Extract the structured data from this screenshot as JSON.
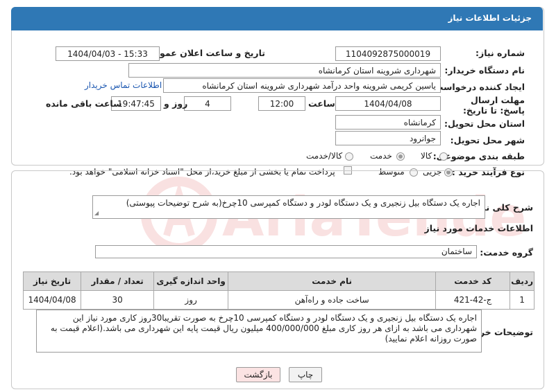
{
  "header": {
    "title": "جزئیات اطلاعات نیاز"
  },
  "fields": {
    "need_number_label": "شماره نیاز:",
    "need_number": "1104092875000019",
    "announce_label": "تاریخ و ساعت اعلان عمومی:",
    "announce_value": "1404/04/03 - 15:33",
    "buyer_org_label": "نام دستگاه خریدار:",
    "buyer_org": "شهرداری شروینه استان کرمانشاه",
    "requester_label": "ایجاد کننده درخواست:",
    "requester": "یاسین کریمی شروینه واحد درآمد شهرداری شروینه استان کرمانشاه",
    "contact_link": "اطلاعات تماس خریدار",
    "deadline_label": "مهلت ارسال پاسخ: تا تاریخ:",
    "deadline_date": "1404/04/08",
    "time_label": "ساعت",
    "deadline_time": "12:00",
    "days_value": "4",
    "days_label": "روز و",
    "remaining_time": "19:47:45",
    "remaining_label": "ساعت باقی مانده",
    "province_label": "استان محل تحویل:",
    "province": "کرمانشاه",
    "city_label": "شهر محل تحویل:",
    "city": "جوانرود",
    "category_label": "طبقه بندی موضوعی:",
    "category_options": [
      "کالا",
      "خدمت",
      "کالا/خدمت"
    ],
    "category_selected": "خدمت",
    "process_label": "نوع فرآیند خرید :",
    "process_options": [
      "جزیی",
      "متوسط"
    ],
    "process_selected": "جزیی",
    "payment_note": "پرداخت تمام یا بخشی از مبلغ خرید،از محل \"اسناد خزانه اسلامی\" خواهد بود."
  },
  "summary": {
    "label": "شرح کلی نیاز:",
    "text": "اجاره یک دستگاه بیل زنجیری و یک دستگاه لودر و دستگاه کمپرسی 10چرخ(به شرح توضیحات پیوستی)"
  },
  "services": {
    "section_title": "اطلاعات خدمات مورد نیاز",
    "group_label": "گروه خدمت:",
    "group_value": "ساختمان",
    "columns": [
      "ردیف",
      "کد خدمت",
      "نام خدمت",
      "واحد اندازه گیری",
      "تعداد / مقدار",
      "تاریخ نیاز"
    ],
    "rows": [
      [
        "1",
        "ج-42-421",
        "ساخت جاده و راه‌آهن",
        "روز",
        "30",
        "1404/04/08"
      ]
    ]
  },
  "buyer_notes": {
    "label": "توضیحات خریدار:",
    "text": "اجاره یک دستگاه بیل زنجیری و یک دستگاه لودر و دستگاه کمپرسی 10چرخ به صورت تقریبا30روز کاری مورد نیاز این شهرداری می باشد به ازای هر روز کاری مبلغ 400/000/000 میلیون ریال قیمت پایه این شهرداری می باشد.(اعلام قیمت به صورت روزانه اعلام نمایید)"
  },
  "buttons": {
    "print": "چاپ",
    "back": "بازگشت"
  },
  "watermark": {
    "text": "AriaTender.net"
  },
  "colors": {
    "header_bg": "#2f78b5",
    "link": "#1a56b0",
    "back_button_bg": "#fbe3e3",
    "watermark": "#d21f1f"
  },
  "icons": [
    "resize-grip-icon",
    "radio-icon",
    "checkbox-icon"
  ]
}
